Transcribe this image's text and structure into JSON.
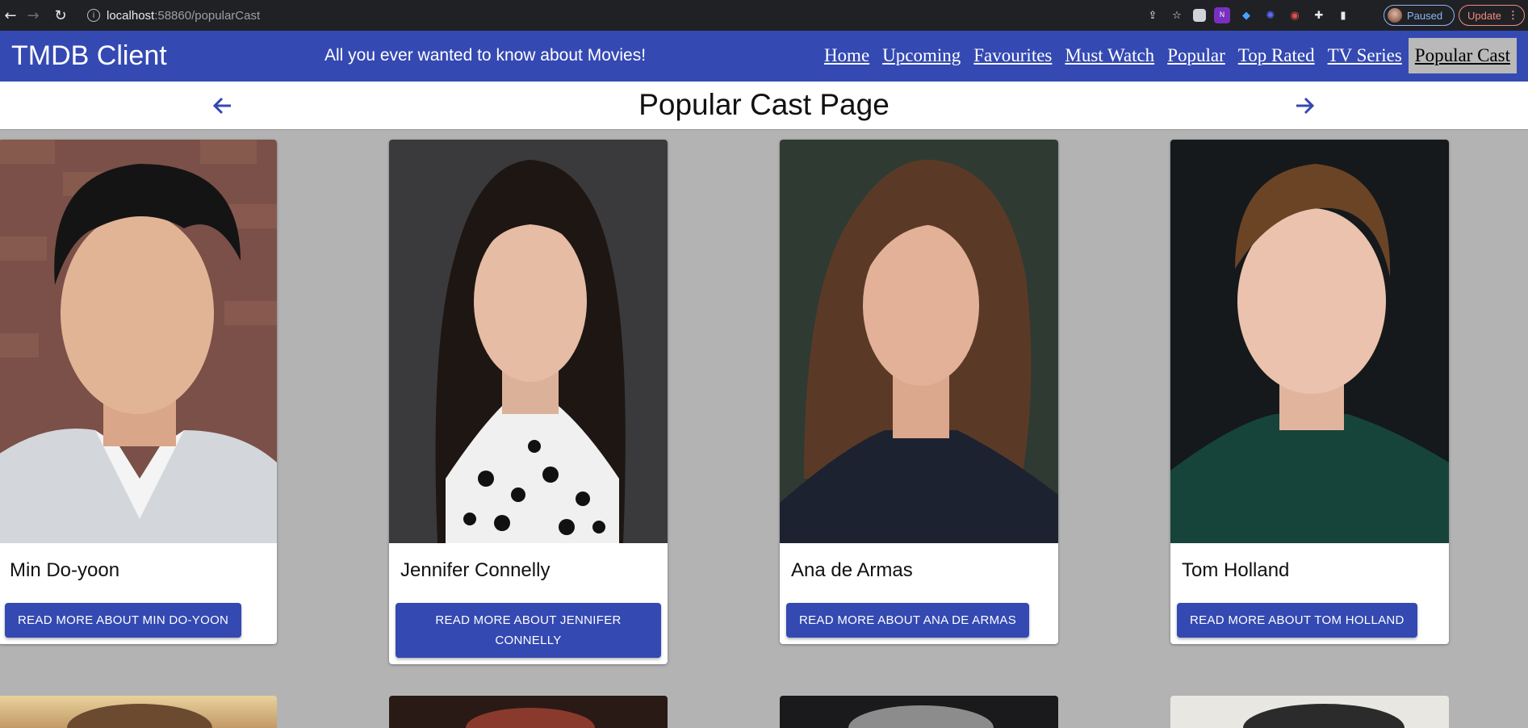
{
  "browser": {
    "url_host": "localhost",
    "url_path": ":58860/popularCast",
    "profile_label": "Paused",
    "update_label": "Update"
  },
  "app": {
    "title": "TMDB Client",
    "tagline": "All you ever wanted to know about Movies!",
    "menu": [
      {
        "label": "Home"
      },
      {
        "label": "Upcoming"
      },
      {
        "label": "Favourites"
      },
      {
        "label": "Must Watch"
      },
      {
        "label": "Popular"
      },
      {
        "label": "Top Rated"
      },
      {
        "label": "TV Series"
      },
      {
        "label": "Popular Cast"
      }
    ]
  },
  "page": {
    "title": "Popular Cast Page"
  },
  "cast": [
    {
      "name": "Min Do-yoon",
      "button": "READ MORE ABOUT MIN DO-YOON"
    },
    {
      "name": "Jennifer Connelly",
      "button": "READ MORE ABOUT JENNIFER CONNELLY"
    },
    {
      "name": "Ana de Armas",
      "button": "READ MORE ABOUT ANA DE ARMAS"
    },
    {
      "name": "Tom Holland",
      "button": "READ MORE ABOUT TOM HOLLAND"
    }
  ],
  "colors": {
    "primary": "#3449b2",
    "page_background": "#b3b3b3",
    "active_menu": "#b9b9b9"
  }
}
